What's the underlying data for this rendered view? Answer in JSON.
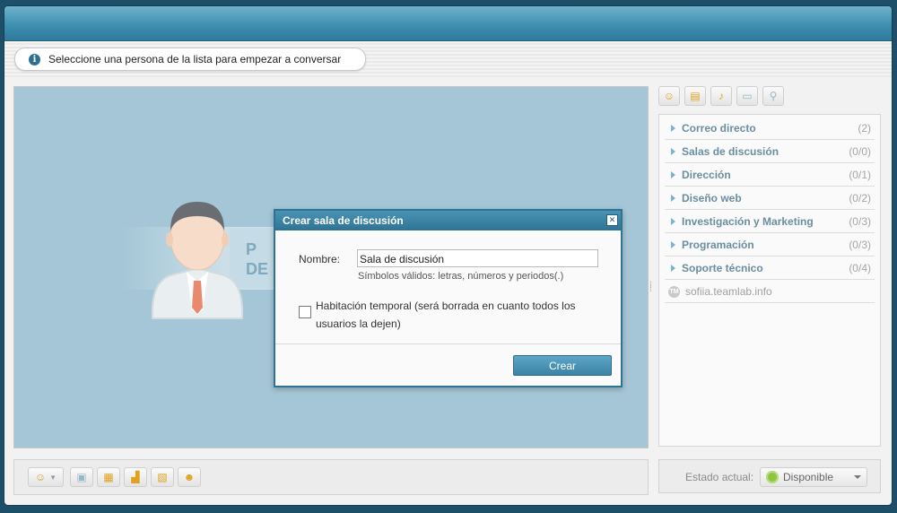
{
  "info": {
    "message": "Seleccione una persona de la lista para empezar a conversar"
  },
  "main": {
    "banner_line1": "P",
    "banner_line2": "DE L"
  },
  "contacts": {
    "groups": [
      {
        "name": "Correo directo",
        "count": "(2)"
      },
      {
        "name": "Salas de discusión",
        "count": "(0/0)"
      },
      {
        "name": "Dirección",
        "count": "(0/1)"
      },
      {
        "name": "Diseño web",
        "count": "(0/2)"
      },
      {
        "name": "Investigación y Marketing",
        "count": "(0/3)"
      },
      {
        "name": "Programación",
        "count": "(0/3)"
      },
      {
        "name": "Soporte técnico",
        "count": "(0/4)"
      }
    ],
    "server": "sofiia.teamlab.info"
  },
  "status": {
    "label": "Estado actual:",
    "value": "Disponible",
    "accent": "#8cc63f"
  },
  "dialog": {
    "title": "Crear sala de discusión",
    "name_label": "Nombre:",
    "name_value": "Sala de discusión",
    "hint": "Símbolos válidos: letras, números y periodos(.)",
    "temp_label": "Habitación temporal (será borrada en cuanto todos los usuarios la dejen)",
    "create_label": "Crear"
  },
  "colors": {
    "titlebar": "#3f8fb0",
    "main_bg": "#a4c6d6",
    "dialog_border": "#2f7394"
  }
}
